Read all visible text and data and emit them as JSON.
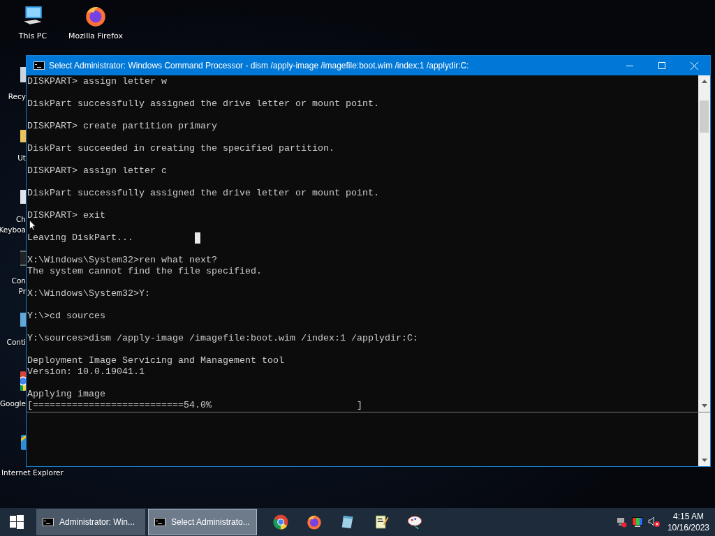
{
  "desktop_icons": [
    {
      "kind": "pc",
      "lines": [
        "This PC"
      ]
    },
    {
      "kind": "firefox",
      "lines": [
        "Mozilla Firefox"
      ]
    }
  ],
  "desktop_icons_behind": [
    {
      "kind": "recycle",
      "lines": [
        "Recy"
      ]
    },
    {
      "kind": "folder",
      "lines": [
        "Ut"
      ]
    },
    {
      "kind": "keyboard",
      "lines": [
        "Ch",
        "Keyboa"
      ]
    },
    {
      "kind": "cmd",
      "lines": [
        "Con",
        "Pr"
      ]
    },
    {
      "kind": "panel",
      "lines": [
        "Conti"
      ]
    },
    {
      "kind": "chrome",
      "lines": [
        "Google"
      ]
    },
    {
      "kind": "ie",
      "lines": [
        "Internet Explorer"
      ]
    }
  ],
  "window": {
    "title": "Select Administrator: Windows Command Processor - dism  /apply-image /imagefile:boot.wim /index:1 /applydir:C:",
    "console": [
      {
        "lines": [
          "DISKPART> assign letter w"
        ],
        "cursor": false
      },
      {
        "lines": [
          "DiskPart successfully assigned the drive letter or mount point."
        ],
        "cursor": false
      },
      {
        "lines": [
          "DISKPART> create partition primary"
        ],
        "cursor": false
      },
      {
        "lines": [
          "DiskPart succeeded in creating the specified partition."
        ],
        "cursor": false
      },
      {
        "lines": [
          "DISKPART> assign letter c"
        ],
        "cursor": false
      },
      {
        "lines": [
          "DiskPart successfully assigned the drive letter or mount point."
        ],
        "cursor": false
      },
      {
        "lines": [
          "DISKPART> exit"
        ],
        "cursor": false
      },
      {
        "lines": [
          "Leaving DiskPart..."
        ],
        "cursor": true
      },
      {
        "lines": [
          "X:\\Windows\\System32>ren what next?",
          "The system cannot find the file specified."
        ],
        "cursor": false
      },
      {
        "lines": [
          "X:\\Windows\\System32>Y:"
        ],
        "cursor": false
      },
      {
        "lines": [
          "Y:\\>cd sources"
        ],
        "cursor": false
      },
      {
        "lines": [
          "Y:\\sources>dism /apply-image /imagefile:boot.wim /index:1 /applydir:C:"
        ],
        "cursor": false
      },
      {
        "lines": [
          "Deployment Image Servicing and Management tool",
          "Version: 10.0.19041.1"
        ],
        "cursor": false
      },
      {
        "lines": [
          "Applying image",
          "[===========================54.0%                          ]"
        ],
        "cursor": false
      }
    ]
  },
  "taskbar": {
    "tasks": [
      {
        "label": "Administrator: Win...",
        "selected": false
      },
      {
        "label": "Select Administrato...",
        "selected": true
      }
    ],
    "pinned": [
      {
        "kind": "chrome"
      },
      {
        "kind": "firefox"
      },
      {
        "kind": "notepad"
      },
      {
        "kind": "editor"
      },
      {
        "kind": "paint"
      }
    ],
    "tray": [
      {
        "kind": "network"
      },
      {
        "kind": "display"
      },
      {
        "kind": "speaker"
      }
    ],
    "time": "4:15 AM",
    "date": "10/16/2023"
  }
}
